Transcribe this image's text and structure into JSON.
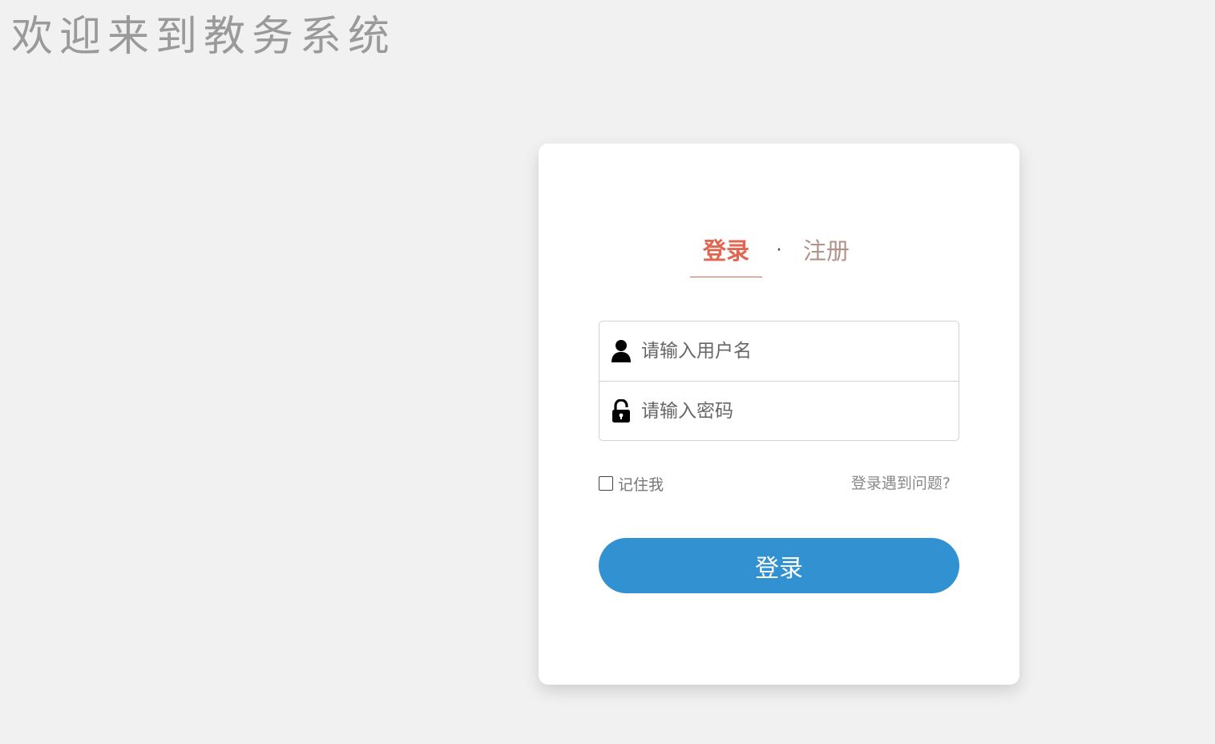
{
  "header": {
    "title": "欢迎来到教务系统"
  },
  "login_card": {
    "tabs": {
      "login": "登录",
      "separator": "·",
      "register": "注册",
      "active": "login"
    },
    "username_field": {
      "placeholder": "请输入用户名",
      "value": "",
      "icon": "user-icon"
    },
    "password_field": {
      "placeholder": "请输入密码",
      "value": "",
      "icon": "lock-icon"
    },
    "remember_me": {
      "label": "记住我",
      "checked": false
    },
    "trouble_link": "登录遇到问题?",
    "submit_label": "登录"
  },
  "colors": {
    "background": "#f1f1f1",
    "active_tab": "#e0664f",
    "inactive_tab": "#b3928a",
    "button": "#3291d0"
  }
}
